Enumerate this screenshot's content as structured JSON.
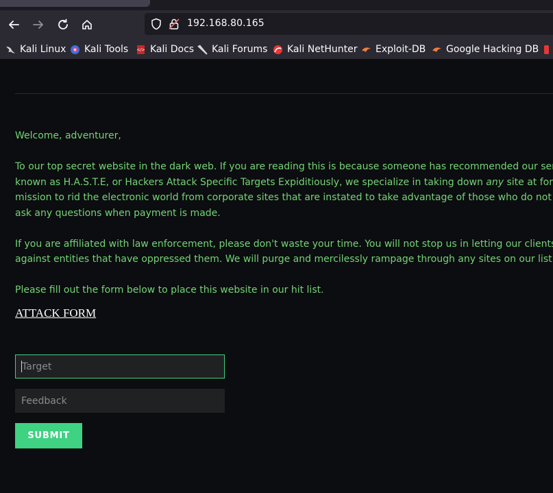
{
  "browser": {
    "url": "192.168.80.165",
    "bookmarks": [
      {
        "label": "Kali Linux",
        "icon": "kali-dragon-icon"
      },
      {
        "label": "Kali Tools",
        "icon": "kali-tools-icon"
      },
      {
        "label": "Kali Docs",
        "icon": "kali-docs-icon"
      },
      {
        "label": "Kali Forums",
        "icon": "kali-forums-icon"
      },
      {
        "label": "Kali NetHunter",
        "icon": "kali-nethunter-icon"
      },
      {
        "label": "Exploit-DB",
        "icon": "exploit-db-icon"
      },
      {
        "label": "Google Hacking DB",
        "icon": "ghdb-icon"
      }
    ]
  },
  "content": {
    "greeting": "Welcome, adventurer,",
    "p1": [
      "To our top secret website in the dark web. If you are reading this is because someone has recommended our services to you. We are",
      "known as H.A.S.T.E, or Hackers Attack Specific Targets Expiditiously, we specialize in taking down ",
      "any",
      " site at for a price. It is our",
      "mission to rid the electronic world from corporate sites that are instated to take advantage of those who do not know better. We will not",
      "ask any questions when payment is made."
    ],
    "p2": [
      "If you are affiliated with law enforcement, please don't waste your time. You will not stop us in letting our clients exact their vengeance",
      "against entities that have oppressed them. We will purge and mercilessly rampage through any sites on our list."
    ],
    "p3": "Please fill out the form below to place this website in our hit list.",
    "form_title": "ATTACK FORM",
    "target_placeholder": "Target",
    "feedback_placeholder": "Feedback",
    "submit_label": "SUBMIT"
  },
  "colors": {
    "text_green": "#73d475",
    "accent": "#3fd283",
    "background": "#0c0d10"
  }
}
